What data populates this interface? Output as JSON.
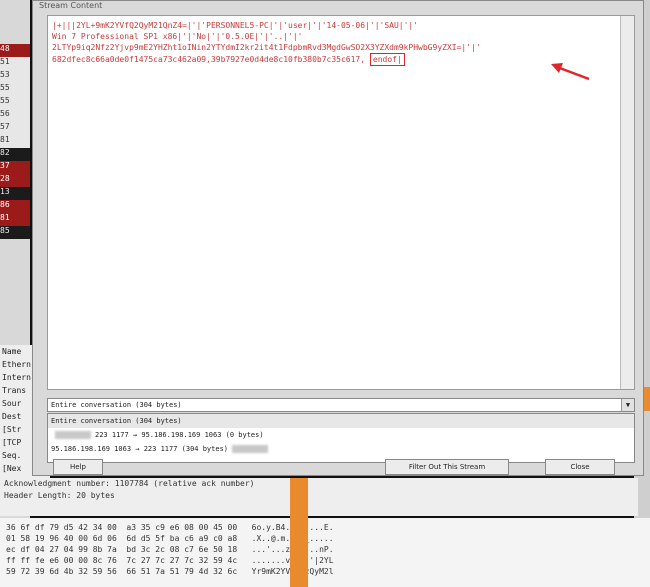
{
  "dialog": {
    "title": "Stream Content",
    "stream_lines": [
      "|+|||2YL+9mK2YVfQ2QyM21QnZ4=|'|'PERSONNEL5-PC|'|'user|'|'14-05-06|'|'SAU|'|'",
      "Win 7 Professional SP1 x86|'|'No|'|'0.5.0E|'|'..|'|'",
      "2LTYp9iq2Nfz2Yjvp9mE2YHZht1oINin2YTYdmI2kr2it4t1FdpbmRvd3MgdGwSO2X3YZXdm9kPHwbG9yZXI=|'|'",
      "682dfec8c66a0de0f1475ca73c462a09,39b7927e0d4de8c10fb380b7c35c617,"
    ],
    "endof_text": "endof|",
    "conversation_select": "Entire conversation (304 bytes)",
    "select_arrow": "▼",
    "conversation_options": [
      "Entire conversation (304 bytes)",
      "223 1177 → 95.186.198.169 1063 (0 bytes)",
      "95.186.198.169 1063 →  223 1177 (304 bytes)"
    ],
    "buttons": {
      "help": "Help",
      "filter": "Filter Out This Stream",
      "close": "Close"
    }
  },
  "background": {
    "row_labels": [
      "48",
      "51",
      "53",
      "55",
      "55",
      "56",
      "57",
      "81",
      "82",
      "37",
      "28",
      "13",
      "86",
      "81",
      "85"
    ],
    "detail_lines": [
      "Name",
      "Ethern",
      "Intern",
      "Trans",
      "Sour",
      "Dest",
      "[Str",
      "[TCP",
      "Seq.",
      "[Nex"
    ],
    "under_lines": [
      "Acknowledgment number: 1107784 (relative ack number)",
      "Header Length: 20 bytes"
    ],
    "hex_lines": [
      "36 6f df 79 d5 42 34 00  a3 35 c9 e6 08 00 45 00   6o.y.B4. .5....E.",
      "01 58 19 96 40 00 6d 06  6d d5 5f ba c6 a9 c0 a8   .X..@.m. m._.....",
      "ec df 04 27 04 99 8b 7a  bd 3c 2c 08 c7 6e 50 18   ...'...z .<,..nP.",
      "ff ff fe e6 00 00 8c 76  7c 27 7c 27 7c 32 59 4c   .......v |'|'|2YL",
      "59 72 39 6d 4b 32 59 56  66 51 7a 51 79 4d 32 6c   Yr9mK2YV fQzQyM2l"
    ]
  }
}
